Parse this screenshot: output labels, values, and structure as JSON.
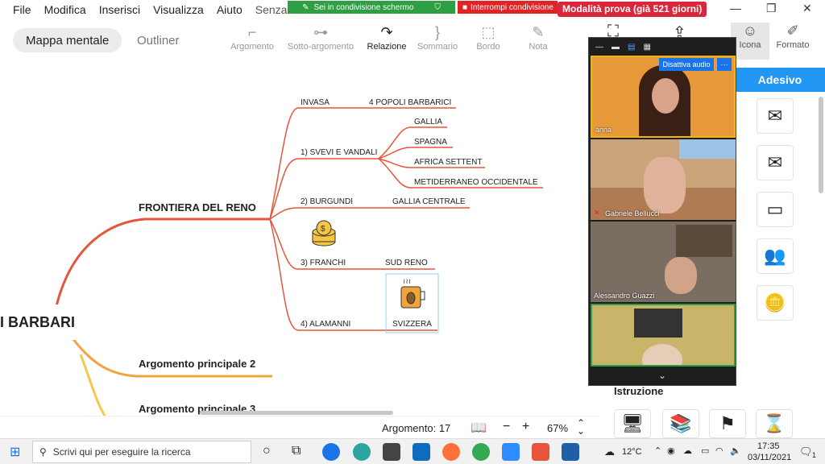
{
  "menu": [
    "File",
    "Modifica",
    "Inserisci",
    "Visualizza",
    "Aiuto",
    "Senza t"
  ],
  "share_banner": "Sei in condivisione schermo",
  "stop_share": "Interrompi condivisione",
  "trial": "Modalità prova (già 521 giorni)",
  "views": {
    "mindmap": "Mappa mentale",
    "outliner": "Outliner"
  },
  "tools": [
    "Argomento",
    "Sotto-argomento",
    "Relazione",
    "Sommario",
    "Bordo",
    "Nota"
  ],
  "right_tools": [
    "Icona",
    "Formato"
  ],
  "panel": {
    "title": "Adesivo",
    "section": "Istruzione"
  },
  "mindmap": {
    "root": "I BARBARI",
    "main1": "FRONTIERA DEL RENO",
    "main2": "Argomento principale 2",
    "main3": "Argomento principale 3",
    "n_invasa": "INVASA",
    "n_4popoli": "4 POPOLI BARBARICI",
    "n_svevi": "1) SVEVI E VANDALI",
    "n_gallia": "GALLIA",
    "n_spagna": "SPAGNA",
    "n_africa": "AFRICA SETTENT",
    "n_medit": "METIDERRANEO OCCIDENTALE",
    "n_burgundi": "2) BURGUNDI",
    "n_gallia_c": "GALLIA CENTRALE",
    "n_franchi": "3) FRANCHI",
    "n_sudreno": "SUD RENO",
    "n_alamanni": "4) ALAMANNI",
    "n_svizzera": "SVIZZERA"
  },
  "status": {
    "topic_count": "Argomento: 17",
    "zoom": "67%",
    "minus": "−",
    "plus": "+"
  },
  "video": {
    "mute": "Disattiva audio",
    "more": "···",
    "participants": [
      "anna",
      "Gabriele Bellucci",
      "Alessandro Guazzi"
    ]
  },
  "taskbar": {
    "search_placeholder": "Scrivi qui per eseguire la ricerca",
    "temp": "12°C",
    "time": "17:35",
    "date": "03/11/2021",
    "notif": "1"
  },
  "colors": {
    "branch": "#e8533c",
    "branch2": "#f2a43c",
    "branch3": "#f5c84a",
    "accent": "#2196f3"
  }
}
